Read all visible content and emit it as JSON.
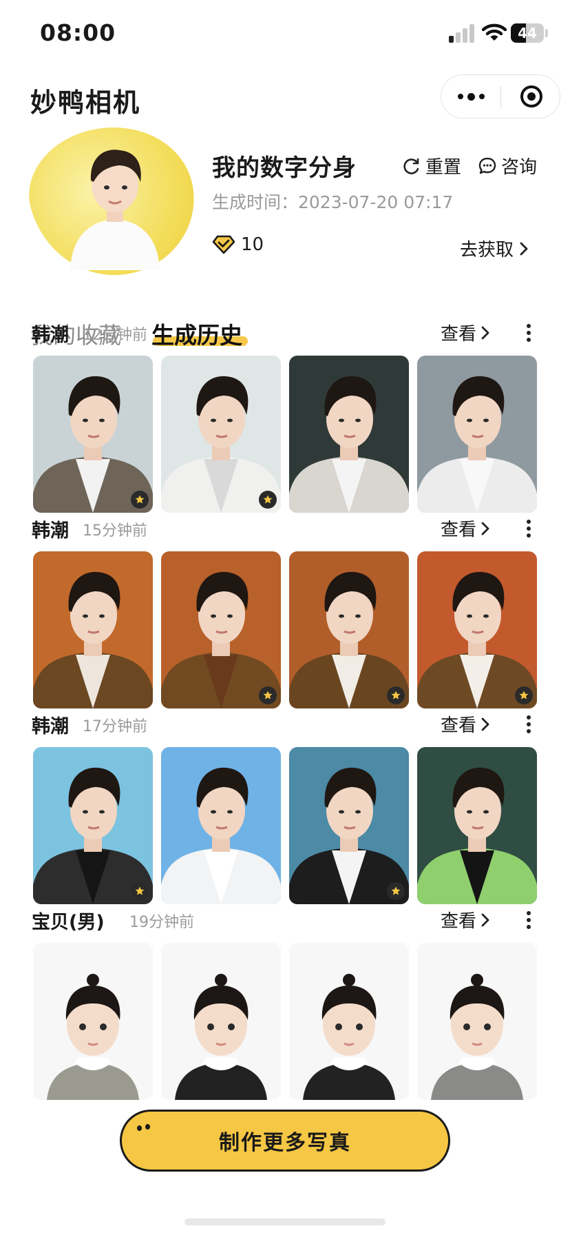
{
  "status_bar": {
    "time": "08:00",
    "battery": "44"
  },
  "header": {
    "app_title": "妙鸭相机"
  },
  "profile": {
    "name": "我的数字分身",
    "reset_label": "重置",
    "consult_label": "咨询",
    "generated_time": "生成时间：2023-07-20 07:17",
    "points": "10",
    "get_more_label": "去获取"
  },
  "tabs": [
    {
      "label": "我的收藏",
      "active": false
    },
    {
      "label": "生成历史",
      "active": true
    }
  ],
  "sections": [
    {
      "title": "韩潮",
      "time": "12分钟前",
      "view_label": "查看",
      "photos": [
        {
          "bg": "#c9d3d6",
          "suit": "#6e6558",
          "shirt": "#f2f2f2",
          "starred": true
        },
        {
          "bg": "#dfe6e6",
          "suit": "#f0f0ee",
          "shirt": "#d9d9d9",
          "starred": true
        },
        {
          "bg": "#2f3a38",
          "suit": "#d8d6cf",
          "shirt": "#f4f4f4",
          "starred": false
        },
        {
          "bg": "#8f9aa0",
          "suit": "#ececec",
          "shirt": "#f8f8f8",
          "starred": false
        }
      ]
    },
    {
      "title": "韩潮",
      "time": "15分钟前",
      "view_label": "查看",
      "photos": [
        {
          "bg": "#c26a2c",
          "suit": "#6b4722",
          "shirt": "#eee6dc",
          "starred": false
        },
        {
          "bg": "#b8612a",
          "suit": "#714a22",
          "shirt": "#6a3a1c",
          "starred": true
        },
        {
          "bg": "#b25e2b",
          "suit": "#6a4620",
          "shirt": "#f1ede6",
          "starred": true
        },
        {
          "bg": "#c35a2e",
          "suit": "#6e4a24",
          "shirt": "#f3efe8",
          "starred": true
        }
      ]
    },
    {
      "title": "韩潮",
      "time": "17分钟前",
      "view_label": "查看",
      "photos": [
        {
          "bg": "#7cc3e0",
          "suit": "#2d2d2d",
          "shirt": "#151515",
          "starred": true
        },
        {
          "bg": "#6fb2e6",
          "suit": "#f1f3f5",
          "shirt": "#ffffff",
          "starred": false
        },
        {
          "bg": "#4c8aa6",
          "suit": "#1d1d1d",
          "shirt": "#f4f4f4",
          "starred": true
        },
        {
          "bg": "#2f4d43",
          "suit": "#8fcf6e",
          "shirt": "#141414",
          "starred": false
        }
      ]
    },
    {
      "title": "宝贝(男)",
      "time": "19分钟前",
      "view_label": "查看",
      "photos": [
        {
          "bg": "#f7f7f7",
          "suit": "#9a9a90",
          "shirt": "#ffffff",
          "starred": false
        },
        {
          "bg": "#f7f7f7",
          "suit": "#222222",
          "shirt": "#ffffff",
          "starred": false
        },
        {
          "bg": "#f7f7f7",
          "suit": "#222222",
          "shirt": "#ffffff",
          "starred": false
        },
        {
          "bg": "#f7f7f7",
          "suit": "#8a8a88",
          "shirt": "#ffffff",
          "starred": false
        }
      ]
    }
  ],
  "floating_button": {
    "label": "制作更多写真"
  },
  "colors": {
    "accent": "#f6c744",
    "underline": "#f6c94a",
    "muted": "#9a9a9a"
  }
}
